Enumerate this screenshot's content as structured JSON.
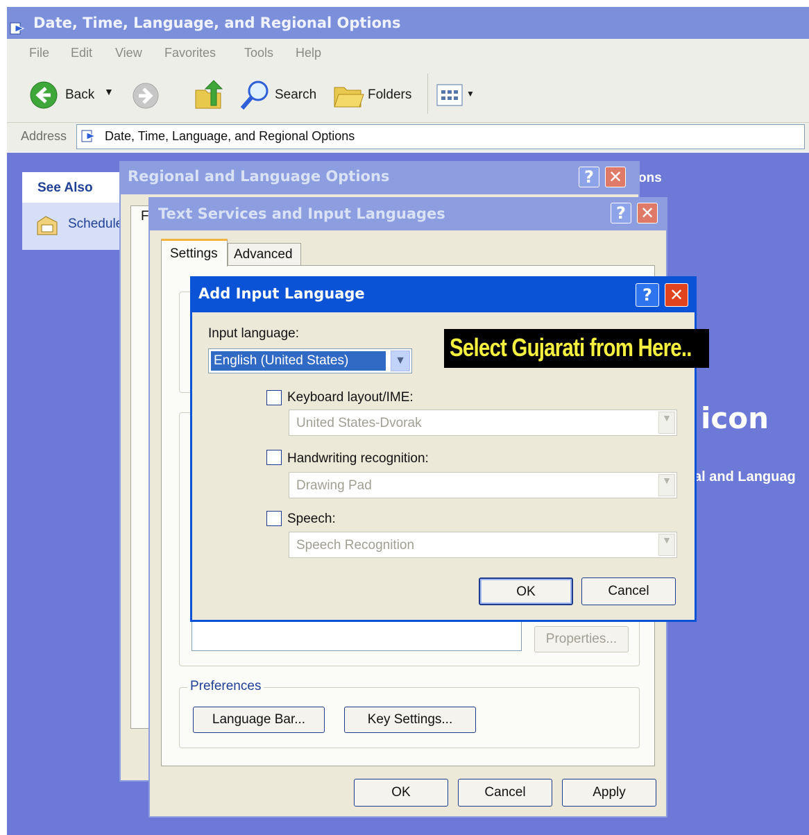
{
  "explorer": {
    "title": "Date, Time, Language, and Regional Options",
    "menu": [
      "File",
      "Edit",
      "View",
      "Favorites",
      "Tools",
      "Help"
    ],
    "toolbar": {
      "back": "Back",
      "search": "Search",
      "folders": "Folders"
    },
    "address_label": "Address",
    "address_value": "Date, Time, Language, and Regional Options",
    "see_also": {
      "heading": "See Also",
      "item": "Schedule"
    },
    "bg_fragments": {
      "title_tail": "ons",
      "icon_word": "icon",
      "sub": "al and Languag"
    }
  },
  "regional_dialog": {
    "title": "Regional and Language Options",
    "tab_fragment": "F"
  },
  "text_services_dialog": {
    "title": "Text Services and Input Languages",
    "tabs": [
      "Settings",
      "Advanced"
    ],
    "properties_button": "Properties...",
    "preferences_label": "Preferences",
    "language_bar_button": "Language Bar...",
    "key_settings_button": "Key Settings...",
    "ok": "OK",
    "cancel": "Cancel",
    "apply": "Apply"
  },
  "add_input_dialog": {
    "title": "Add Input Language",
    "input_language_label": "Input language:",
    "input_language_value": "English (United States)",
    "keyboard_label": "Keyboard layout/IME:",
    "keyboard_value": "United States-Dvorak",
    "handwriting_label": "Handwriting recognition:",
    "handwriting_value": "Drawing Pad",
    "speech_label": "Speech:",
    "speech_value": "Speech Recognition",
    "ok": "OK",
    "cancel": "Cancel"
  },
  "annotation": "Select Gujarati from Here..",
  "colors": {
    "xp_blue": "#0a53d6",
    "annotation_bg": "#000000",
    "annotation_text": "#f5ef3f",
    "close_red": "#e0431e"
  }
}
